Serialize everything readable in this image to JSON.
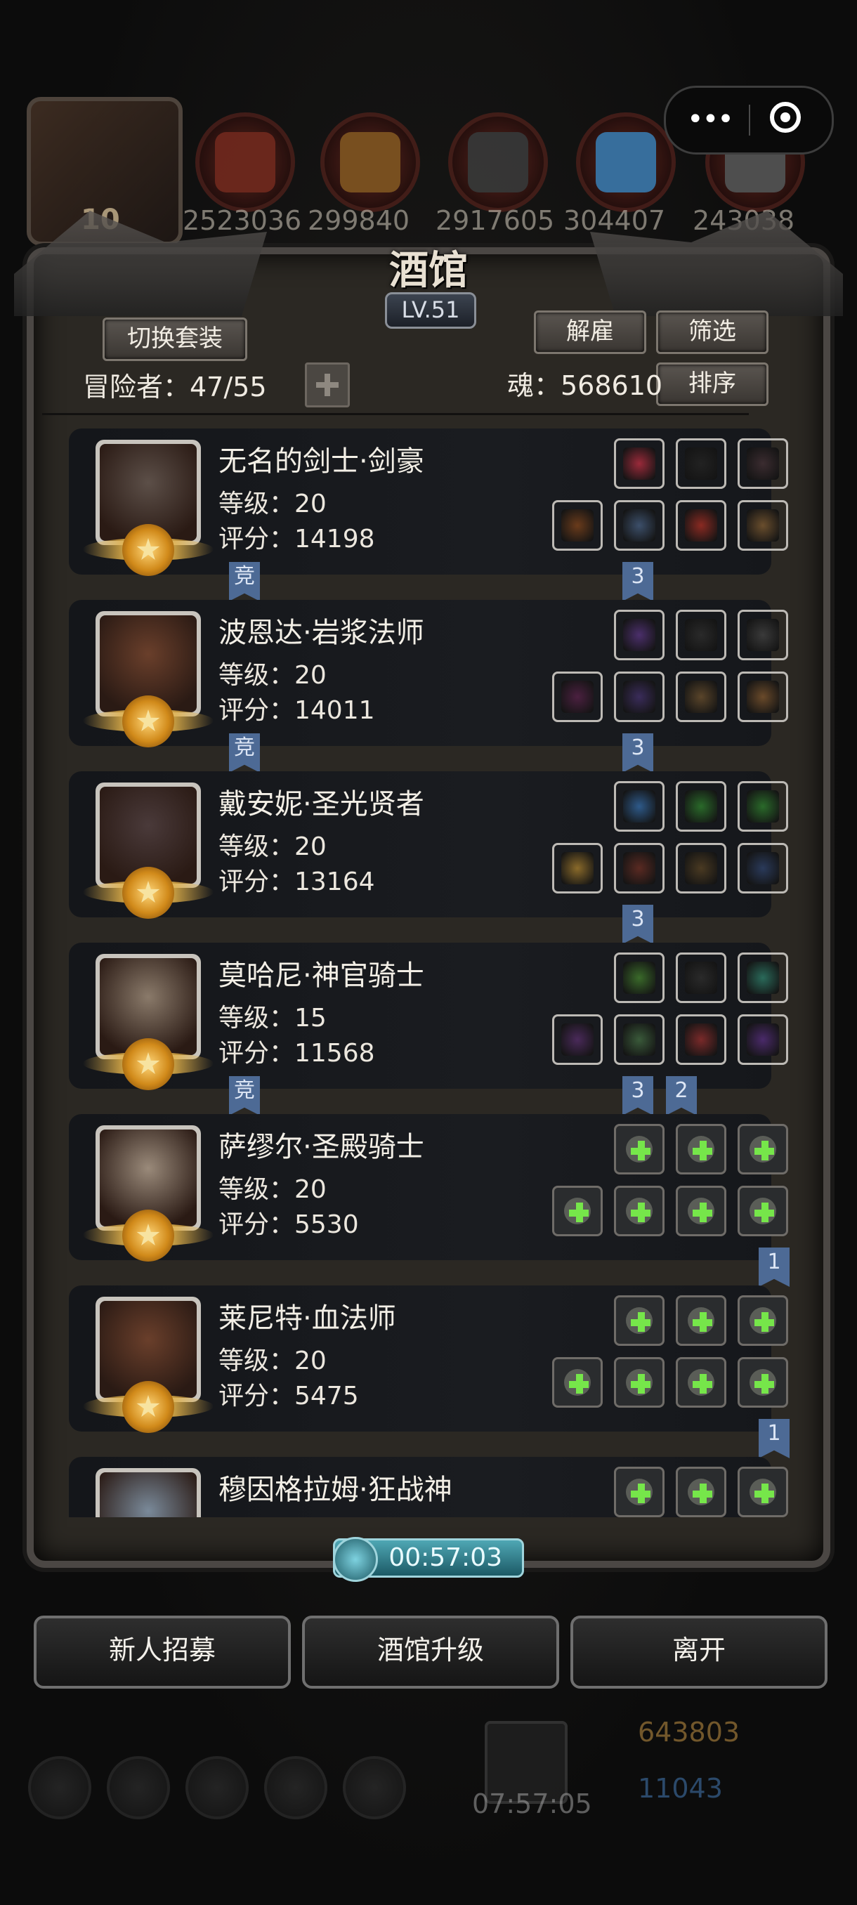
{
  "header": {
    "avatar_level": "10",
    "resources": [
      {
        "name": "ore",
        "value": "2523036",
        "color": "#7a2b1f"
      },
      {
        "name": "wood",
        "value": "299840",
        "color": "#8a5a22"
      },
      {
        "name": "iron",
        "value": "2917605",
        "color": "#3c3c3c"
      },
      {
        "name": "crystal",
        "value": "304407",
        "color": "#3e7fb5"
      },
      {
        "name": "stone",
        "value": "243038",
        "color": "#5a5a5a"
      }
    ]
  },
  "panel": {
    "title": "酒馆",
    "level": "LV.51",
    "switch_outfit_label": "切换套装",
    "dismiss_label": "解雇",
    "filter_label": "筛选",
    "sort_label": "排序",
    "adventurers_label": "冒险者：47/55",
    "soul_label": "魂：568610"
  },
  "heroes": [
    {
      "name": "无名的剑士·剑豪",
      "level": "等级：20",
      "score": "评分：14198",
      "portrait_color": "#5c4f48",
      "top_items": [
        "#9a2a3a",
        "#222",
        "#3b2c30"
      ],
      "bottom_items": [
        "#6a3b1b",
        "#3c4f6a",
        "#8a2a22",
        "#6a4e2d"
      ],
      "flags_left": [
        "竞"
      ],
      "flags_right": [
        "3"
      ]
    },
    {
      "name": "波恩达·岩浆法师",
      "level": "等级：20",
      "score": "评分：14011",
      "portrait_color": "#6a3f2b",
      "top_items": [
        "#4b2f6b",
        "#2a2a2a",
        "#3a3a3a"
      ],
      "bottom_items": [
        "#4b2040",
        "#3a2c5a",
        "#5a452a",
        "#6a4a2a"
      ],
      "flags_left": [
        "竞"
      ],
      "flags_right": [
        "3"
      ]
    },
    {
      "name": "戴安妮·圣光贤者",
      "level": "等级：20",
      "score": "评分：13164",
      "portrait_color": "#4a3a3a",
      "top_items": [
        "#2e5a8a",
        "#2a6a2a",
        "#2a6a2a"
      ],
      "bottom_items": [
        "#8a6a2a",
        "#5a2a22",
        "#4a3a22",
        "#2a3a5a"
      ],
      "flags_left": [],
      "flags_right": [
        "3"
      ]
    },
    {
      "name": "莫哈尼·神官骑士",
      "level": "等级：15",
      "score": "评分：11568",
      "portrait_color": "#8a7a6a",
      "top_items": [
        "#3a6a2a",
        "#2a2a2a",
        "#2a6a5a"
      ],
      "bottom_items": [
        "#4a2a5a",
        "#3a5a3a",
        "#7a2a2a",
        "#4a2a6a"
      ],
      "flags_left": [
        "竞"
      ],
      "flags_right": [
        "3",
        "2"
      ]
    },
    {
      "name": "萨缪尔·圣殿骑士",
      "level": "等级：20",
      "score": "评分：5530",
      "portrait_color": "#9a8a7a",
      "top_items": [
        "empty",
        "empty",
        "empty"
      ],
      "bottom_items": [
        "empty",
        "empty",
        "empty",
        "empty"
      ],
      "flags_left": [],
      "flags_right": [
        "1"
      ]
    },
    {
      "name": "莱尼特·血法师",
      "level": "等级：20",
      "score": "评分：5475",
      "portrait_color": "#6a3f2b",
      "top_items": [
        "empty",
        "empty",
        "empty"
      ],
      "bottom_items": [
        "empty",
        "empty",
        "empty",
        "empty"
      ],
      "flags_left": [],
      "flags_right": [
        "1"
      ]
    },
    {
      "name": "穆因格拉姆·狂战神",
      "level": "",
      "score": "",
      "portrait_color": "#7a8a9a",
      "top_items": [
        "empty",
        "empty",
        "empty"
      ],
      "bottom_items": [],
      "flags_left": [],
      "flags_right": []
    }
  ],
  "timer": {
    "value": "00:57:03"
  },
  "actions": {
    "recruit_label": "新人招募",
    "upgrade_label": "酒馆升级",
    "leave_label": "离开"
  },
  "bottom": {
    "gift_timer": "07:57:05",
    "gold": "643803",
    "gems": "11043"
  }
}
